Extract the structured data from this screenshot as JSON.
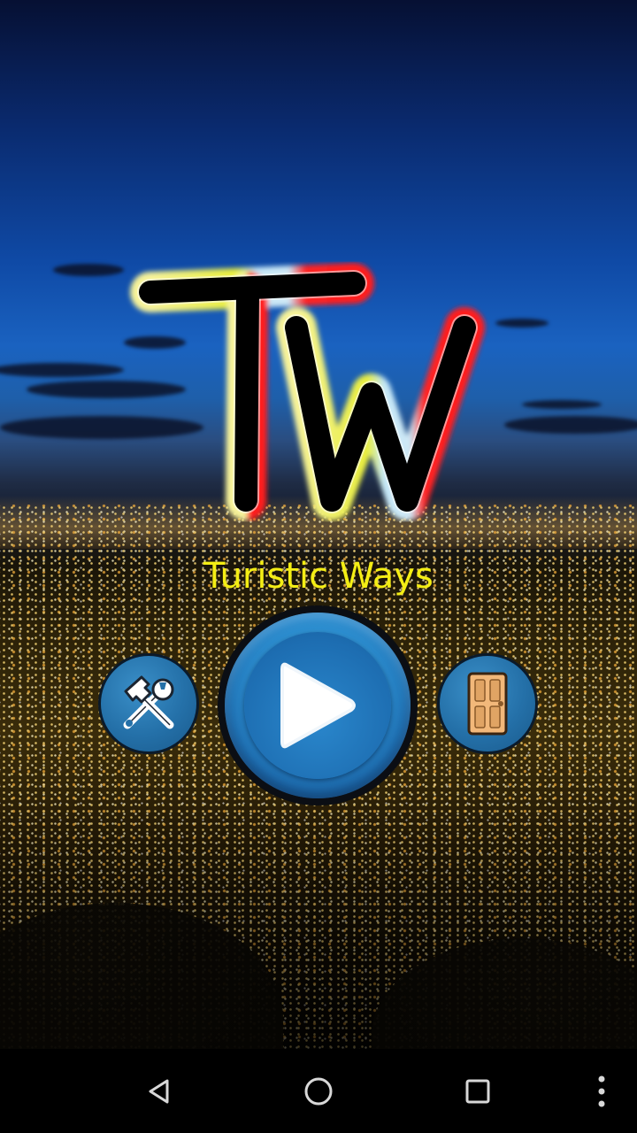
{
  "app": {
    "logo_text": "TW",
    "title": "Turistic Ways"
  },
  "buttons": {
    "settings": {
      "icon": "hammer-wrench-icon"
    },
    "play": {
      "icon": "play-icon"
    },
    "exit": {
      "icon": "door-icon"
    }
  },
  "nav_bar": {
    "back": {
      "icon": "back-triangle-icon"
    },
    "home": {
      "icon": "home-circle-icon"
    },
    "recents": {
      "icon": "recents-square-icon"
    },
    "menu": {
      "icon": "more-vert-icon"
    }
  },
  "colors": {
    "title": "#f4ee14",
    "button_blue": "#2470a8",
    "logo_yellow": "#f4f06a",
    "logo_cyan": "#bfe6f7",
    "logo_red": "#ff1a1a"
  }
}
